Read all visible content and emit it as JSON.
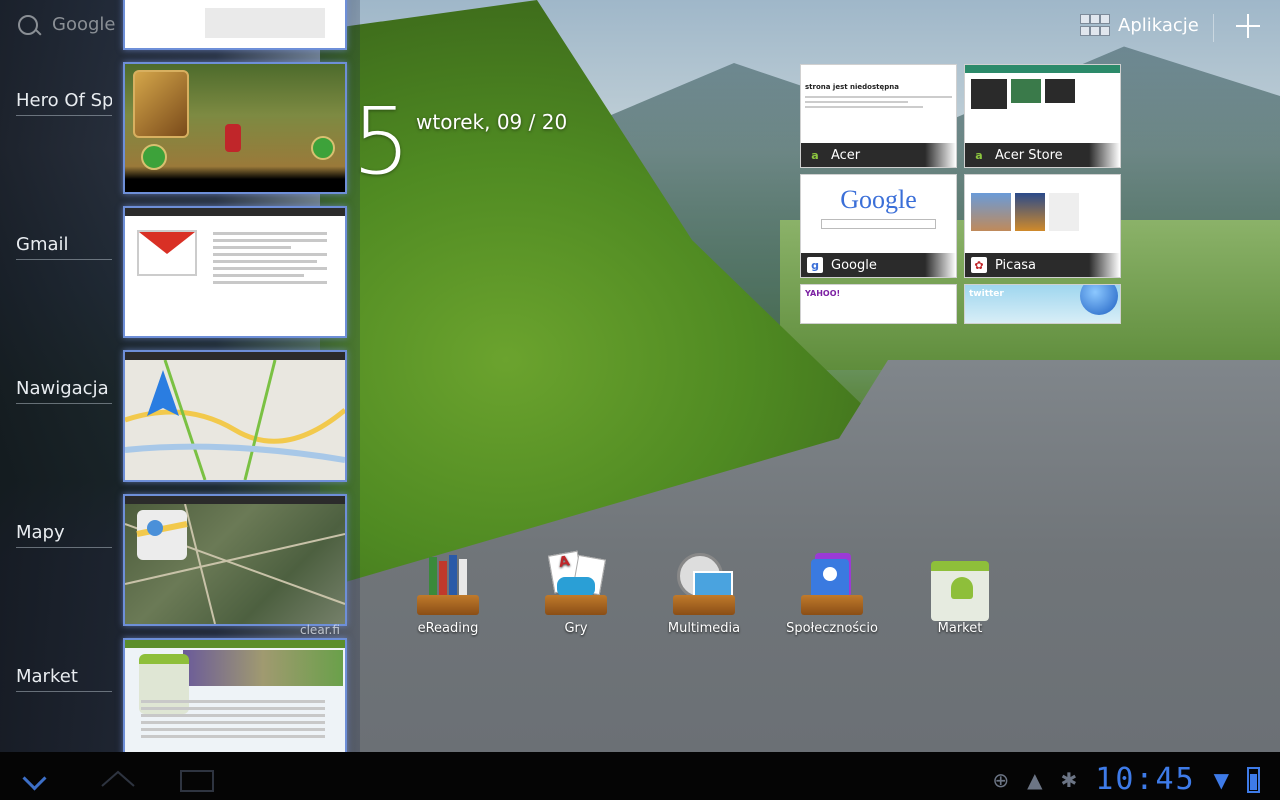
{
  "search": {
    "placeholder": "Google"
  },
  "recent_apps": [
    {
      "label": "Hero Of Spa"
    },
    {
      "label": "Gmail"
    },
    {
      "label": "Nawigacja"
    },
    {
      "label": "Mapy"
    },
    {
      "label": "Market"
    }
  ],
  "watermark": "clear.fi",
  "clock": {
    "big_digit": "5",
    "date": "wtorek, 09 / 20"
  },
  "top_bar": {
    "apps_label": "Aplikacje"
  },
  "bookmarks": [
    {
      "label": "Acer",
      "icon": "acer-icon",
      "header": "strona jest niedostępna"
    },
    {
      "label": "Acer Store",
      "icon": "acer-icon"
    },
    {
      "label": "Google",
      "icon": "google-icon",
      "logo": "Google"
    },
    {
      "label": "Picasa",
      "icon": "picasa-icon"
    }
  ],
  "bookmarks_partial": [
    {
      "logo": "YAHOO!"
    },
    {
      "logo": "twitter"
    }
  ],
  "dock": [
    {
      "label": "eReading",
      "icon": "books-icon"
    },
    {
      "label": "Gry",
      "icon": "games-icon"
    },
    {
      "label": "Multimedia",
      "icon": "multimedia-icon"
    },
    {
      "label": "Społecznościo",
      "icon": "social-icon"
    },
    {
      "label": "Market",
      "icon": "market-icon"
    }
  ],
  "status_bar": {
    "time": "10:45"
  },
  "colors": {
    "accent": "#3e7be8",
    "thumb_border": "#6e8fd8"
  }
}
